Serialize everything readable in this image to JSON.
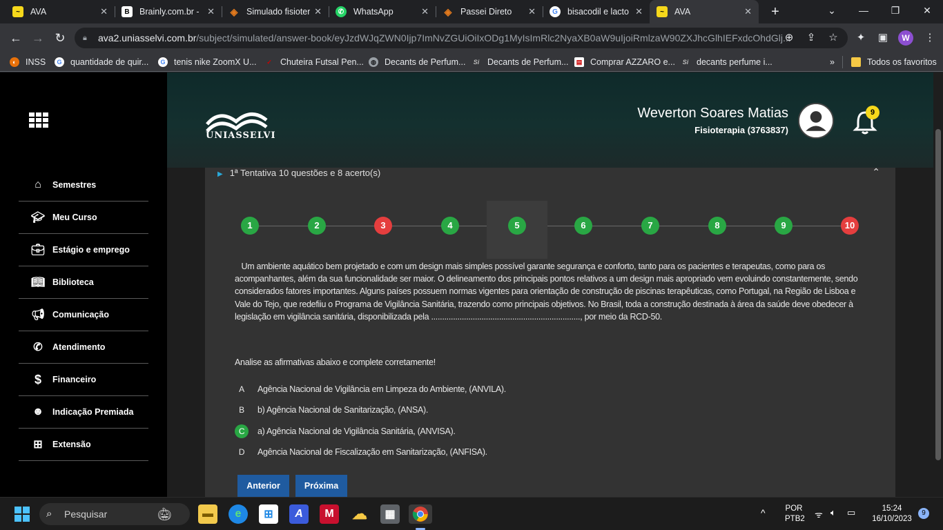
{
  "browser": {
    "tabs": [
      {
        "title": "AVA",
        "icon": "ava-icon",
        "color": "#f6d81b"
      },
      {
        "title": "Brainly.com.br -",
        "icon": "brainly-icon",
        "color": "#000000"
      },
      {
        "title": "Simulado fisioter",
        "icon": "passei-direto-icon",
        "color": "#e37a1d"
      },
      {
        "title": "WhatsApp",
        "icon": "whatsapp-icon",
        "color": "#25d366"
      },
      {
        "title": "Passei Direto",
        "icon": "passei-direto-icon",
        "color": "#e37a1d"
      },
      {
        "title": "bisacodil e lacto",
        "icon": "google-icon",
        "color": "#4285f4"
      },
      {
        "title": "AVA",
        "icon": "ava-icon",
        "color": "#f6d81b"
      }
    ],
    "url_host": "ava2.uniasselvi.com.br",
    "url_path": "/subject/simulated/answer-book/eyJzdWJqZWN0Ijp7ImNvZGUiOiIxODg1MyIsImRlc2NyaXB0aW9uIjoiRmlzaW90ZXJhcGlhIEFxdcOhdGlj...",
    "profile_letter": "W",
    "bookmarks": [
      {
        "label": "INSS",
        "color": "#e8710a"
      },
      {
        "label": "quantidade de quir...",
        "color": "#4285f4"
      },
      {
        "label": "tenis nike ZoomX U...",
        "color": "#4285f4"
      },
      {
        "label": "Chuteira Futsal Pen...",
        "color": "#cc0000"
      },
      {
        "label": "Decants de Perfum...",
        "color": "#9aa0a6"
      },
      {
        "label": "Decants de Perfum...",
        "color": "#444444"
      },
      {
        "label": "Comprar AZZARO e...",
        "color": "#ffffff"
      },
      {
        "label": "decants perfume i...",
        "color": "#444444"
      }
    ],
    "bookmarks_folder": "Todos os favoritos"
  },
  "sidebar": {
    "items": [
      {
        "label": "Semestres",
        "icon": "home-icon"
      },
      {
        "label": "Meu Curso",
        "icon": "graduation-cap-icon"
      },
      {
        "label": "Estágio e emprego",
        "icon": "briefcase-icon"
      },
      {
        "label": "Biblioteca",
        "icon": "book-icon"
      },
      {
        "label": "Comunicação",
        "icon": "megaphone-icon"
      },
      {
        "label": "Atendimento",
        "icon": "phone-icon"
      },
      {
        "label": "Financeiro",
        "icon": "dollar-icon"
      },
      {
        "label": "Indicação Premiada",
        "icon": "group-icon"
      },
      {
        "label": "Extensão",
        "icon": "extension-icon"
      }
    ]
  },
  "header": {
    "logo_text": "UNIASSELVI",
    "user_name": "Weverton Soares Matias",
    "course": "Fisioterapia (3763837)",
    "notifications": "9"
  },
  "quiz": {
    "attempt": "1ª Tentativa  10 questões e 8 acerto(s)",
    "current_step": 5,
    "steps": [
      {
        "n": "1",
        "status": "correct"
      },
      {
        "n": "2",
        "status": "correct"
      },
      {
        "n": "3",
        "status": "wrong"
      },
      {
        "n": "4",
        "status": "correct"
      },
      {
        "n": "5",
        "status": "correct"
      },
      {
        "n": "6",
        "status": "correct"
      },
      {
        "n": "7",
        "status": "correct"
      },
      {
        "n": "8",
        "status": "correct"
      },
      {
        "n": "9",
        "status": "correct"
      },
      {
        "n": "10",
        "status": "wrong"
      }
    ],
    "colors": {
      "correct": "#29a744",
      "wrong": "#e53e3e"
    },
    "question": "   Um ambiente aquático bem projetado e com um design mais simples possível garante segurança e conforto, tanto para os pacientes e terapeutas, como para os acompanhantes, além da sua funcionalidade ser maior. O delineamento dos principais pontos relativos a um design mais apropriado vem evoluindo constantemente, sendo considerados fatores importantes. Alguns países possuem normas vigentes para orientação de construção de piscinas terapêuticas, como Portugal, na Região de Lisboa e Vale do Tejo, que redefiiu o Programa de Vigilância Sanitária, trazendo como principais objetivos. No Brasil, toda a construção destinada à área da saúde deve obedecer à legislação em vigilância sanitária, disponibilizada pela ...................................................................., por meio da RCD-50.",
    "instruction": "Analise as afirmativas abaixo e complete corretamente!",
    "options": [
      {
        "letter": "A",
        "text": "Agência Nacional de Vigilância em Limpeza do Ambiente, (ANVILA).",
        "selected": false
      },
      {
        "letter": "B",
        "text": "b) Agência Nacional de Sanitarização, (ANSA).",
        "selected": false
      },
      {
        "letter": "C",
        "text": "a) Agência Nacional de Vigilância Sanitária, (ANVISA).",
        "selected": true
      },
      {
        "letter": "D",
        "text": "Agência Nacional de Fiscalização em Sanitarização, (ANFISA).",
        "selected": false
      }
    ],
    "prev_label": "Anterior",
    "next_label": "Próxima"
  },
  "taskbar": {
    "search_placeholder": "Pesquisar",
    "lang_line1": "POR",
    "lang_line2": "PTB2",
    "time": "15:24",
    "date": "16/10/2023",
    "notification_count": "9"
  }
}
